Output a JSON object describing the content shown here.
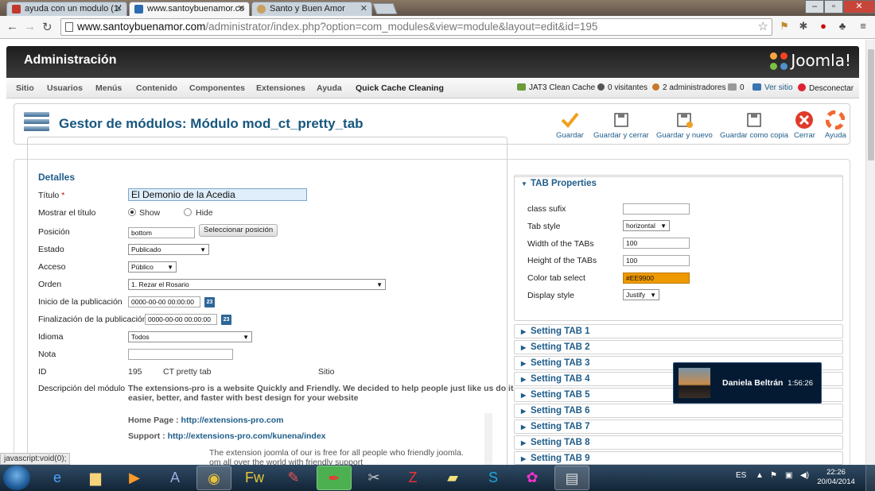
{
  "browser": {
    "tabs": [
      {
        "title": "ayuda con un modulo (1/",
        "color": "#c0392b"
      },
      {
        "title": "www.santoybuenamor.co",
        "color": "#2b6bb0"
      },
      {
        "title": "Santo y Buen Amor",
        "color": "#c8a060"
      }
    ],
    "url_host": "www.santoybuenamor.com",
    "url_path": "/administrator/index.php?option=com_modules&view=module&layout=edit&id=195",
    "status_text": "javascript:void(0);"
  },
  "admin": {
    "title": "Administración",
    "logo_text": "Joomla!",
    "menu": [
      "Sitio",
      "Usuarios",
      "Menús",
      "Contenido",
      "Componentes",
      "Extensiones",
      "Ayuda",
      "Quick Cache Cleaning"
    ],
    "status": {
      "cache": "JAT3 Clean Cache",
      "visitors": "0 visitantes",
      "admins": "2 administradores",
      "messages": "0",
      "view_site": "Ver sitio",
      "logout": "Desconectar"
    }
  },
  "page": {
    "title": "Gestor de módulos: Módulo mod_ct_pretty_tab",
    "toolbar": {
      "save": "Guardar",
      "save_close": "Guardar y cerrar",
      "save_new": "Guardar y nuevo",
      "save_copy": "Guardar como copia",
      "close": "Cerrar",
      "help": "Ayuda"
    }
  },
  "details": {
    "legend": "Detalles",
    "title_label": "Título",
    "title_required": "*",
    "title_value": "El Demonio de la Acedia",
    "show_title_label": "Mostrar el título",
    "show_option": "Show",
    "hide_option": "Hide",
    "position_label": "Posición",
    "position_value": "bottom",
    "position_button": "Seleccionar posición",
    "state_label": "Estado",
    "state_value": "Publicado",
    "access_label": "Acceso",
    "access_value": "Público",
    "order_label": "Orden",
    "order_value": "1. Rezar el Rosario",
    "publish_up_label": "Inicio de la publicación",
    "publish_up_value": "0000-00-00 00:00:00",
    "publish_down_label": "Finalización de la publicación",
    "publish_down_value": "0000-00-00 00:00:00",
    "calendar_glyph": "23",
    "language_label": "Idioma",
    "language_value": "Todos",
    "note_label": "Nota",
    "note_value": "",
    "id_label": "ID",
    "id_value": "195",
    "module_type": "CT pretty tab",
    "client": "Sitio",
    "description_label": "Descripción del módulo",
    "description_line1": "The extensions-pro is a website Quickly and Friendly. We decided to help people just like us do it",
    "description_line2": "easier, better, and faster with best design for your website",
    "homepage_label": "Home Page : ",
    "homepage_link": "http://extensions-pro.com",
    "support_label": "Support : ",
    "support_link": "http://extensions-pro.com/kunena/index",
    "description_cut1": "The extension joomla of our is free for all people who friendly joomla.",
    "description_cut2": "om all over the world with friendly support"
  },
  "tab_properties": {
    "header": "TAB Properties",
    "class_sufix_label": "class sufix",
    "class_sufix_value": "",
    "tab_style_label": "Tab style",
    "tab_style_value": "horizontal",
    "width_label": "Width of the TABs",
    "width_value": "100",
    "height_label": "Height of the TABs",
    "height_value": "100",
    "color_label": "Color tab select",
    "color_value": "#EE9900",
    "display_label": "Display style",
    "display_value": "Justify"
  },
  "setting_tabs": [
    "Setting TAB 1",
    "Setting TAB 2",
    "Setting TAB 3",
    "Setting TAB 4",
    "Setting TAB 5",
    "Setting TAB 6",
    "Setting TAB 7",
    "Setting TAB 8",
    "Setting TAB 9"
  ],
  "notification": {
    "name": "Daniela Beltrán",
    "time": "1:56:26"
  },
  "taskbar": {
    "language": "ES",
    "time": "22:26",
    "date": "20/04/2014"
  },
  "colors": {
    "accent": "#1f5d8a",
    "tab_color": "#EE9900",
    "header_bg": "#2a2a2a"
  }
}
